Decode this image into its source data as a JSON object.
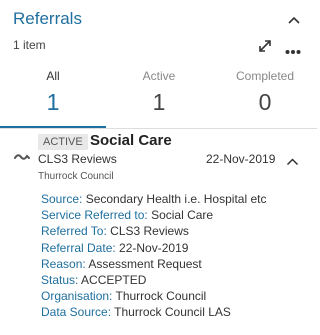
{
  "header": {
    "title": "Referrals",
    "count": "1 item"
  },
  "tabs": [
    {
      "label": "All",
      "count": "1"
    },
    {
      "label": "Active",
      "count": "1"
    },
    {
      "label": "Completed",
      "count": "0"
    }
  ],
  "item": {
    "status": "ACTIVE",
    "type": "Social Care",
    "name": "CLS3 Reviews",
    "organisation": "Thurrock Council",
    "date": "22-Nov-2019",
    "details": [
      {
        "label": "Source:",
        "value": "Secondary Health i.e. Hospital etc"
      },
      {
        "label": "Service Referred to:",
        "value": "Social Care"
      },
      {
        "label": "Referred To:",
        "value": "CLS3 Reviews"
      },
      {
        "label": "Referral Date:",
        "value": "22-Nov-2019"
      },
      {
        "label": "Reason:",
        "value": "Assessment Request"
      },
      {
        "label": "Status:",
        "value": "ACCEPTED"
      },
      {
        "label": "Organisation:",
        "value": "Thurrock Council"
      },
      {
        "label": "Data Source:",
        "value": "Thurrock Council LAS"
      }
    ]
  },
  "icons": {
    "collapse": "chevron-up-icon",
    "expand": "expand-arrows-icon",
    "more": "more-dots-icon",
    "referral": "referral-wave-icon"
  },
  "colors": {
    "accent": "#1f6f9f",
    "badge_bg": "#e8e8e8",
    "text": "#333333"
  }
}
